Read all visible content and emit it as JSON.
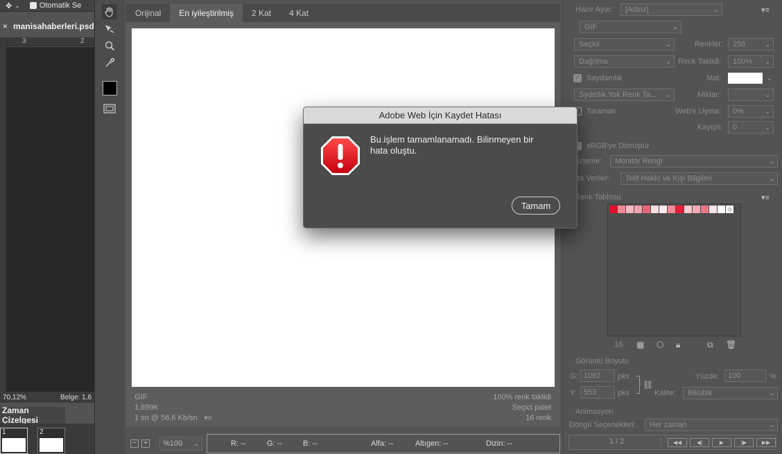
{
  "ps": {
    "auto_select_label": "Otomatik Se",
    "doc_close": "×",
    "doc_name": "manisahaberleri.psd",
    "ruler_3": "3",
    "ruler_2": "2",
    "zoom_pct": "70,12%",
    "doc_info": "Belge: 1,6",
    "timeline_title": "Zaman Çizelgesi",
    "frames": [
      {
        "num": "1"
      },
      {
        "num": "2"
      }
    ]
  },
  "preview": {
    "tabs": [
      {
        "label": "Orijinal"
      },
      {
        "label": "En iyileştirilmiş",
        "active": true
      },
      {
        "label": "2 Kat"
      },
      {
        "label": "4 Kat"
      }
    ],
    "info_format": "GIF",
    "info_size": "1,899K",
    "info_time": "1 sn @ 56,6 Kb/sn",
    "info_dither": "100% renk taklidi",
    "info_palette": "Seçici palet",
    "info_colors": "16 renk",
    "zoom_value": "%100",
    "readout": {
      "r": "R: --",
      "g": "G: --",
      "b": "B: --",
      "alpha": "Alfa: --",
      "hex": "Altıgen: --",
      "index": "Dizin: --"
    }
  },
  "settings": {
    "preset_label": "Hazır Ayar:",
    "preset_value": "[Adsız]",
    "format": "GIF",
    "reduction": "Seçici",
    "colors_label": "Renkler:",
    "colors_value": "256",
    "dither_algo": "Dağıtma",
    "dither_label": "Renk Taklidi:",
    "dither_value": "100%",
    "transparency_label": "Saydamlık",
    "matte_label": "Mat:",
    "trans_dither": "Sydmlık Yok Renk Ta...",
    "amount_label": "Miktar:",
    "interlaced_label": "Taramalı",
    "websnap_label": "Web'e Uyma:",
    "websnap_value": "0%",
    "lossy_label": "Kayıplı:",
    "lossy_value": "0",
    "srgb_label": "sRGB'ye Dönüştür",
    "preview_label": "nizleme:",
    "preview_value": "Monitör Rengi",
    "metadata_label": "ata Veriler:",
    "metadata_value": "Telif Hakkı ve Kişi Bilgileri",
    "color_table_title": "Renk Tablosu",
    "color_count": "16",
    "swatches": [
      "#e0102a",
      "#ef8a98",
      "#f4b9c1",
      "#f6a2ae",
      "#ec6477",
      "#fbdde2",
      "#fdecef",
      "#f28b99",
      "#e4203a",
      "#f9c9d0",
      "#f6aab4",
      "#ee7384",
      "#fce3e7",
      "#ffffff"
    ],
    "image_size_title": "Görüntü Boyutu",
    "w_label": "G:",
    "w_value": "1062",
    "h_label": "Y:",
    "h_value": "553",
    "px_unit": "pks",
    "percent_label": "Yüzde:",
    "percent_value": "100",
    "percent_unit": "%",
    "quality_label": "Kalite:",
    "quality_value": "Bikübik",
    "animation_title": "Animasyon",
    "loop_label": "Döngü Seçenekleri:",
    "loop_value": "Her zaman",
    "frame_counter": "1 / 2"
  },
  "dialog": {
    "title": "Adobe Web İçin Kaydet Hatası",
    "message": "Bu.işlem tamamlanamadı. Bilinmeyen bir hata oluştu.",
    "ok_label": "Tamam"
  },
  "colors": {
    "error_red": "#d8101c",
    "matte_white": "#ffffff"
  }
}
